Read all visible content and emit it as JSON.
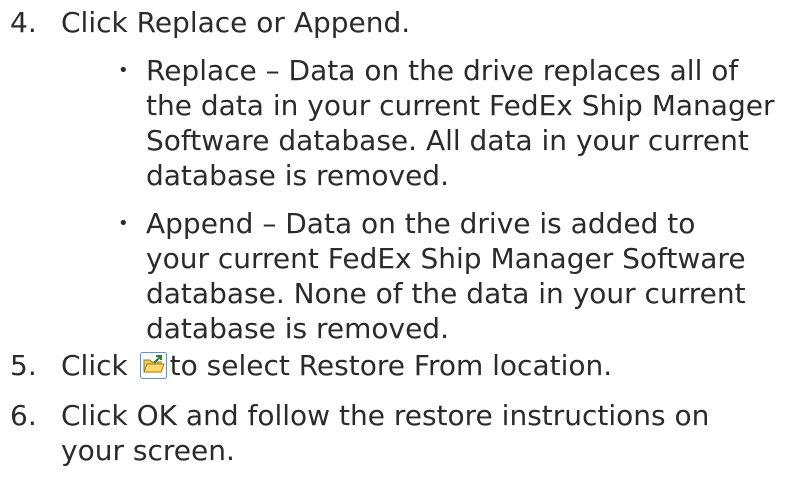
{
  "steps": [
    {
      "number": "4.",
      "lines": [
        "Click Replace or Append."
      ],
      "subitems": [
        {
          "bullet": "•",
          "lines": [
            "Replace – Data on the drive replaces all of",
            "the data in your current FedEx Ship Manager",
            "Software database. All data in your current",
            "database is removed."
          ]
        },
        {
          "bullet": "•",
          "lines": [
            "Append – Data on the drive is added to",
            "your current FedEx Ship Manager Software",
            "database. None of the data in your current",
            "database is removed."
          ]
        }
      ]
    },
    {
      "number": "5.",
      "before_icon": "Click",
      "icon": "open-folder-icon",
      "after_icon": "to select Restore From location."
    },
    {
      "number": "6.",
      "lines": [
        "Click OK and follow the restore instructions on",
        "your screen."
      ]
    }
  ],
  "colors": {
    "text": "#2b2b2b",
    "icon_frame": "#6d8fb0",
    "icon_folder": "#f2c94c",
    "icon_arrow": "#2e7d32"
  }
}
